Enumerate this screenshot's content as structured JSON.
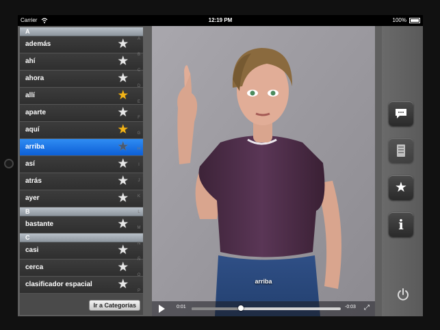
{
  "status": {
    "carrier": "Carrier",
    "time": "12:19 PM",
    "battery": "100%"
  },
  "sections": [
    {
      "header": "A",
      "words": [
        {
          "label": "además",
          "favorite": false,
          "selected": false
        },
        {
          "label": "ahí",
          "favorite": false,
          "selected": false
        },
        {
          "label": "ahora",
          "favorite": false,
          "selected": false
        },
        {
          "label": "allí",
          "favorite": true,
          "selected": false
        },
        {
          "label": "aparte",
          "favorite": false,
          "selected": false
        },
        {
          "label": "aquí",
          "favorite": true,
          "selected": false
        },
        {
          "label": "arriba",
          "favorite": false,
          "selected": true
        },
        {
          "label": "así",
          "favorite": false,
          "selected": false
        },
        {
          "label": "atrás",
          "favorite": false,
          "selected": false
        },
        {
          "label": "ayer",
          "favorite": false,
          "selected": false
        }
      ]
    },
    {
      "header": "B",
      "words": [
        {
          "label": "bastante",
          "favorite": false,
          "selected": false
        }
      ]
    },
    {
      "header": "C",
      "words": [
        {
          "label": "casi",
          "favorite": false,
          "selected": false
        },
        {
          "label": "cerca",
          "favorite": false,
          "selected": false
        },
        {
          "label": "clasificador espacial",
          "favorite": false,
          "selected": false
        }
      ]
    }
  ],
  "index_letters": [
    "A",
    "B",
    "C",
    "D",
    "E",
    "F",
    "G",
    "H",
    "I",
    "J",
    "K",
    "L",
    "M",
    "N",
    "Ñ",
    "O",
    "P",
    "Q",
    "R"
  ],
  "categories_button": "Ir a Categorías",
  "video": {
    "caption": "arriba",
    "elapsed": "0:01",
    "remaining": "-0:03",
    "progress": 0.33
  },
  "side_buttons": [
    {
      "name": "comments-button",
      "icon": "speech-bubble-icon"
    },
    {
      "name": "notebook-button",
      "icon": "notebook-icon"
    },
    {
      "name": "favorites-button",
      "icon": "star-icon"
    },
    {
      "name": "info-button",
      "icon": "info-icon"
    }
  ],
  "colors": {
    "selected_row": "#1a74e8",
    "favorite_star": "#f2b418",
    "panel_bg": "#4a4a4a"
  }
}
